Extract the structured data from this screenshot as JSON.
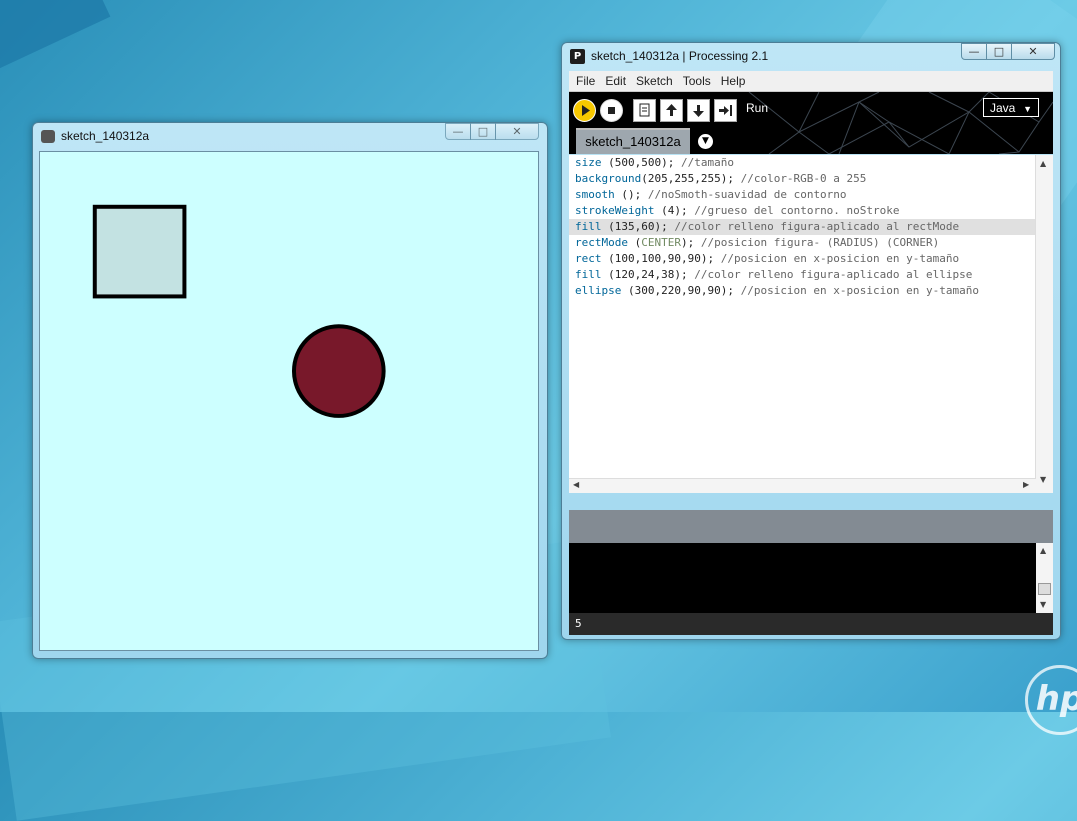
{
  "sketch_window": {
    "title": "sketch_140312a",
    "background_color": "#CDFFFF",
    "square_fill": "#C3E2E2",
    "circle_fill": "#78182A"
  },
  "pde_window": {
    "title": "sketch_140312a | Processing 2.1",
    "menu": [
      "File",
      "Edit",
      "Sketch",
      "Tools",
      "Help"
    ],
    "toolbar": {
      "run_label": "Run",
      "mode": "Java"
    },
    "tab": "sketch_140312a",
    "code": [
      {
        "kw": "size",
        "rest": " (500,500); ",
        "comment": "//tamaño"
      },
      {
        "kw": "background",
        "rest": "(205,255,255); ",
        "comment": "//color-RGB-0 a 255"
      },
      {
        "kw": "smooth",
        "rest": " (); ",
        "comment": "//noSmoth-suavidad de contorno"
      },
      {
        "kw": "strokeWeight",
        "rest": " (4); ",
        "comment": "//grueso del contorno. noStroke"
      },
      {
        "kw": "fill",
        "rest": " (135,60); ",
        "comment": "//color relleno figura-aplicado al rectMode"
      },
      {
        "kw": "rectMode",
        "rest": " (",
        "const": "CENTER",
        "rest2": "); ",
        "comment": "//posicion figura- (RADIUS) (CORNER)"
      },
      {
        "kw": "rect",
        "rest": " (100,100,90,90); ",
        "comment": "//posicion en x-posicion en y-tamaño"
      },
      {
        "kw": "fill",
        "rest": " (120,24,38); ",
        "comment": "//color relleno figura-aplicado al ellipse"
      },
      {
        "kw": "ellipse",
        "rest": " (300,220,90,90); ",
        "comment": "//posicion en x-posicion en y-tamaño"
      }
    ],
    "line_number": "5"
  },
  "icons": {
    "minimize": "minimize-icon",
    "maximize": "maximize-icon",
    "close": "close-icon"
  }
}
